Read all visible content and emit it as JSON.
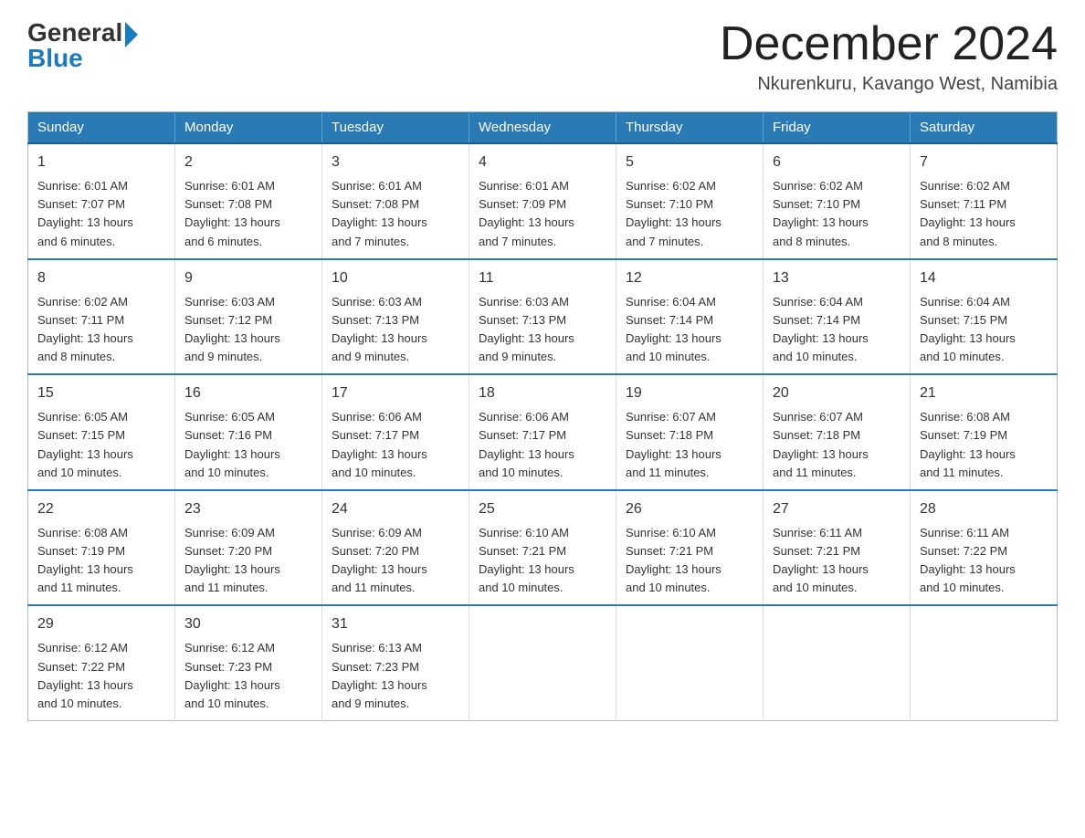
{
  "logo": {
    "general_text": "General",
    "blue_text": "Blue"
  },
  "header": {
    "title": "December 2024",
    "subtitle": "Nkurenkuru, Kavango West, Namibia"
  },
  "days_of_week": [
    "Sunday",
    "Monday",
    "Tuesday",
    "Wednesday",
    "Thursday",
    "Friday",
    "Saturday"
  ],
  "weeks": [
    [
      {
        "day": "1",
        "sunrise": "6:01 AM",
        "sunset": "7:07 PM",
        "daylight": "13 hours and 6 minutes."
      },
      {
        "day": "2",
        "sunrise": "6:01 AM",
        "sunset": "7:08 PM",
        "daylight": "13 hours and 6 minutes."
      },
      {
        "day": "3",
        "sunrise": "6:01 AM",
        "sunset": "7:08 PM",
        "daylight": "13 hours and 7 minutes."
      },
      {
        "day": "4",
        "sunrise": "6:01 AM",
        "sunset": "7:09 PM",
        "daylight": "13 hours and 7 minutes."
      },
      {
        "day": "5",
        "sunrise": "6:02 AM",
        "sunset": "7:10 PM",
        "daylight": "13 hours and 7 minutes."
      },
      {
        "day": "6",
        "sunrise": "6:02 AM",
        "sunset": "7:10 PM",
        "daylight": "13 hours and 8 minutes."
      },
      {
        "day": "7",
        "sunrise": "6:02 AM",
        "sunset": "7:11 PM",
        "daylight": "13 hours and 8 minutes."
      }
    ],
    [
      {
        "day": "8",
        "sunrise": "6:02 AM",
        "sunset": "7:11 PM",
        "daylight": "13 hours and 8 minutes."
      },
      {
        "day": "9",
        "sunrise": "6:03 AM",
        "sunset": "7:12 PM",
        "daylight": "13 hours and 9 minutes."
      },
      {
        "day": "10",
        "sunrise": "6:03 AM",
        "sunset": "7:13 PM",
        "daylight": "13 hours and 9 minutes."
      },
      {
        "day": "11",
        "sunrise": "6:03 AM",
        "sunset": "7:13 PM",
        "daylight": "13 hours and 9 minutes."
      },
      {
        "day": "12",
        "sunrise": "6:04 AM",
        "sunset": "7:14 PM",
        "daylight": "13 hours and 10 minutes."
      },
      {
        "day": "13",
        "sunrise": "6:04 AM",
        "sunset": "7:14 PM",
        "daylight": "13 hours and 10 minutes."
      },
      {
        "day": "14",
        "sunrise": "6:04 AM",
        "sunset": "7:15 PM",
        "daylight": "13 hours and 10 minutes."
      }
    ],
    [
      {
        "day": "15",
        "sunrise": "6:05 AM",
        "sunset": "7:15 PM",
        "daylight": "13 hours and 10 minutes."
      },
      {
        "day": "16",
        "sunrise": "6:05 AM",
        "sunset": "7:16 PM",
        "daylight": "13 hours and 10 minutes."
      },
      {
        "day": "17",
        "sunrise": "6:06 AM",
        "sunset": "7:17 PM",
        "daylight": "13 hours and 10 minutes."
      },
      {
        "day": "18",
        "sunrise": "6:06 AM",
        "sunset": "7:17 PM",
        "daylight": "13 hours and 10 minutes."
      },
      {
        "day": "19",
        "sunrise": "6:07 AM",
        "sunset": "7:18 PM",
        "daylight": "13 hours and 11 minutes."
      },
      {
        "day": "20",
        "sunrise": "6:07 AM",
        "sunset": "7:18 PM",
        "daylight": "13 hours and 11 minutes."
      },
      {
        "day": "21",
        "sunrise": "6:08 AM",
        "sunset": "7:19 PM",
        "daylight": "13 hours and 11 minutes."
      }
    ],
    [
      {
        "day": "22",
        "sunrise": "6:08 AM",
        "sunset": "7:19 PM",
        "daylight": "13 hours and 11 minutes."
      },
      {
        "day": "23",
        "sunrise": "6:09 AM",
        "sunset": "7:20 PM",
        "daylight": "13 hours and 11 minutes."
      },
      {
        "day": "24",
        "sunrise": "6:09 AM",
        "sunset": "7:20 PM",
        "daylight": "13 hours and 11 minutes."
      },
      {
        "day": "25",
        "sunrise": "6:10 AM",
        "sunset": "7:21 PM",
        "daylight": "13 hours and 10 minutes."
      },
      {
        "day": "26",
        "sunrise": "6:10 AM",
        "sunset": "7:21 PM",
        "daylight": "13 hours and 10 minutes."
      },
      {
        "day": "27",
        "sunrise": "6:11 AM",
        "sunset": "7:21 PM",
        "daylight": "13 hours and 10 minutes."
      },
      {
        "day": "28",
        "sunrise": "6:11 AM",
        "sunset": "7:22 PM",
        "daylight": "13 hours and 10 minutes."
      }
    ],
    [
      {
        "day": "29",
        "sunrise": "6:12 AM",
        "sunset": "7:22 PM",
        "daylight": "13 hours and 10 minutes."
      },
      {
        "day": "30",
        "sunrise": "6:12 AM",
        "sunset": "7:23 PM",
        "daylight": "13 hours and 10 minutes."
      },
      {
        "day": "31",
        "sunrise": "6:13 AM",
        "sunset": "7:23 PM",
        "daylight": "13 hours and 9 minutes."
      },
      null,
      null,
      null,
      null
    ]
  ]
}
